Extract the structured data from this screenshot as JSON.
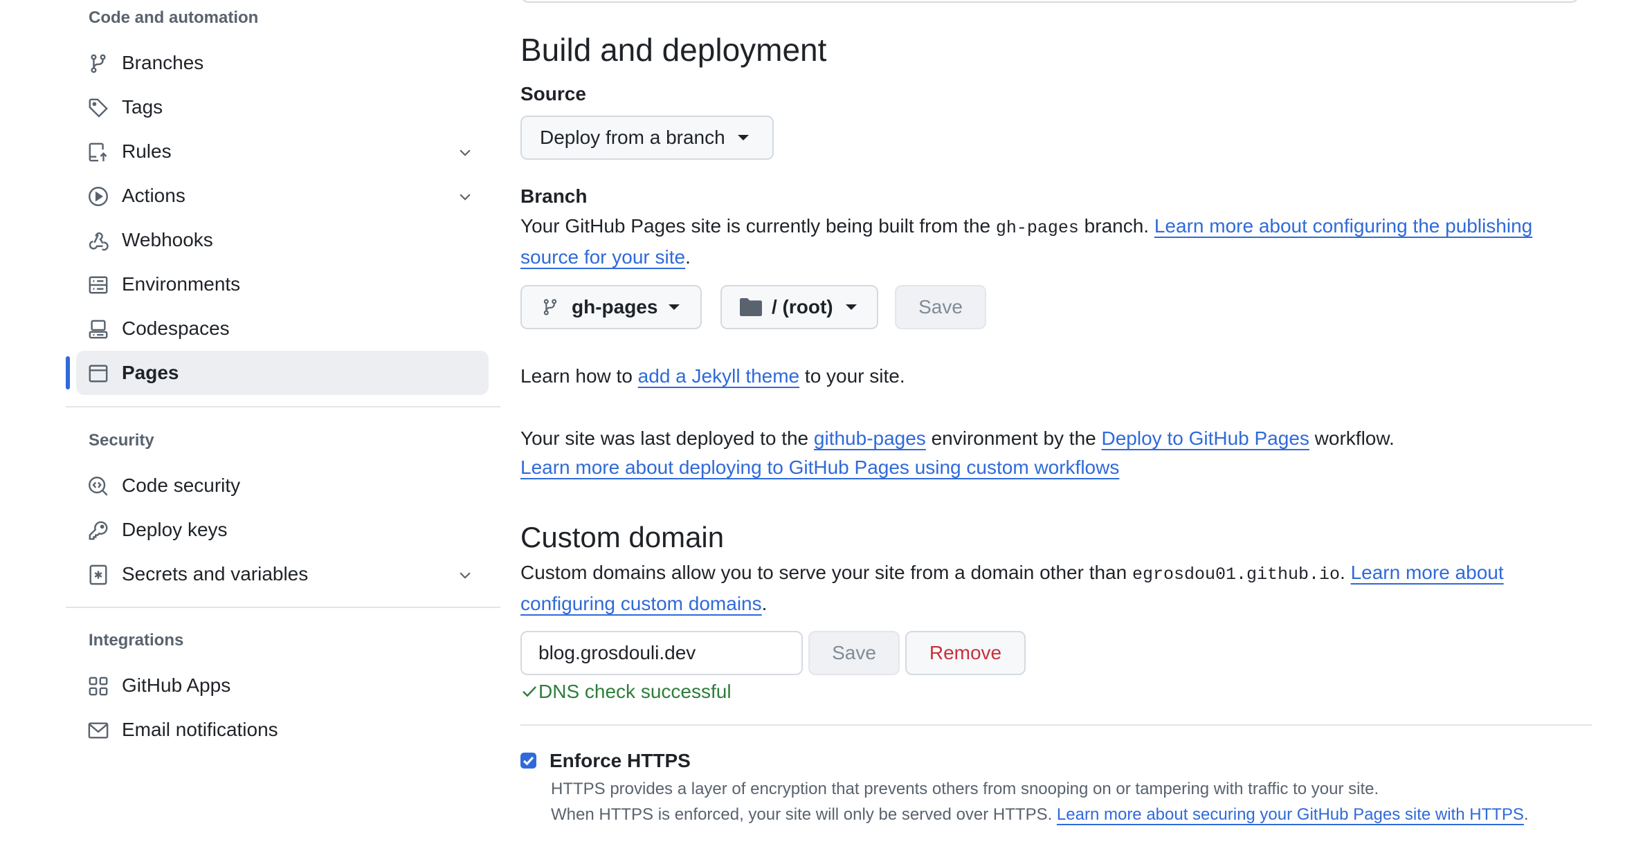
{
  "sidebar": {
    "sections": [
      {
        "heading": "Code and automation",
        "items": [
          {
            "label": "Branches",
            "icon": "git-branch-icon",
            "chevron": false,
            "active": false
          },
          {
            "label": "Tags",
            "icon": "tag-icon",
            "chevron": false,
            "active": false
          },
          {
            "label": "Rules",
            "icon": "rules-icon",
            "chevron": true,
            "active": false
          },
          {
            "label": "Actions",
            "icon": "play-circle-icon",
            "chevron": true,
            "active": false
          },
          {
            "label": "Webhooks",
            "icon": "webhook-icon",
            "chevron": false,
            "active": false
          },
          {
            "label": "Environments",
            "icon": "server-icon",
            "chevron": false,
            "active": false
          },
          {
            "label": "Codespaces",
            "icon": "codespaces-icon",
            "chevron": false,
            "active": false
          },
          {
            "label": "Pages",
            "icon": "browser-icon",
            "chevron": false,
            "active": true
          }
        ]
      },
      {
        "heading": "Security",
        "items": [
          {
            "label": "Code security",
            "icon": "codescan-icon",
            "chevron": false,
            "active": false
          },
          {
            "label": "Deploy keys",
            "icon": "key-icon",
            "chevron": false,
            "active": false
          },
          {
            "label": "Secrets and variables",
            "icon": "key-asterisk-icon",
            "chevron": true,
            "active": false
          }
        ]
      },
      {
        "heading": "Integrations",
        "items": [
          {
            "label": "GitHub Apps",
            "icon": "apps-icon",
            "chevron": false,
            "active": false
          },
          {
            "label": "Email notifications",
            "icon": "mail-icon",
            "chevron": false,
            "active": false
          }
        ]
      }
    ]
  },
  "build": {
    "title": "Build and deployment",
    "source_label": "Source",
    "source_value": "Deploy from a branch",
    "branch_label": "Branch",
    "branch_text_pre": "Your GitHub Pages site is currently being built from the ",
    "branch_code": "gh-pages",
    "branch_text_post": " branch. ",
    "branch_link_1": "Learn more about configuring the publishing",
    "branch_link_2": "source for your site",
    "branch_period": ".",
    "branch_select": "gh-pages",
    "folder_select": "/ (root)",
    "save_label": "Save",
    "jekyll_pre": "Learn how to ",
    "jekyll_link": "add a Jekyll theme",
    "jekyll_post": " to your site.",
    "deployed_pre": "Your site was last deployed to the ",
    "deployed_env_link": "github-pages",
    "deployed_mid": " environment by the ",
    "deployed_workflow_link": "Deploy to GitHub Pages",
    "deployed_post": " workflow.",
    "workflows_link": "Learn more about deploying to GitHub Pages using custom workflows"
  },
  "custom_domain": {
    "title": "Custom domain",
    "desc_pre": "Custom domains allow you to serve your site from a domain other than ",
    "desc_code": "egrosdou01.github.io",
    "desc_post": ". ",
    "desc_link_1": "Learn more about",
    "desc_link_2": "configuring custom domains",
    "desc_period": ".",
    "input_value": "blog.grosdouli.dev",
    "save_label": "Save",
    "remove_label": "Remove",
    "dns_status": "DNS check successful"
  },
  "https": {
    "checked": true,
    "label": "Enforce HTTPS",
    "desc_1": "HTTPS provides a layer of encryption that prevents others from snooping on or tampering with traffic to your site.",
    "desc_2_pre": "When HTTPS is enforced, your site will only be served over HTTPS. ",
    "desc_2_link": "Learn more about securing your GitHub Pages site with HTTPS",
    "desc_2_period": "."
  },
  "colors": {
    "accent": "#2f6ad9",
    "success": "#2d7d3a",
    "danger": "#c9303b",
    "muted": "#59636e"
  }
}
